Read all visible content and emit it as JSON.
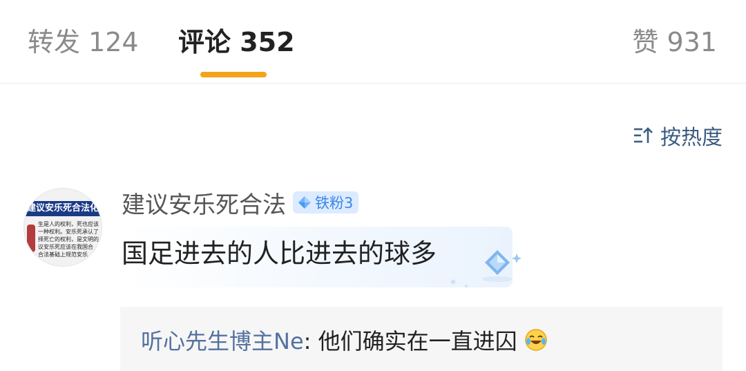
{
  "tabs": {
    "repost_label": "转发 124",
    "comments_label": "评论 352",
    "likes_label": "赞 931",
    "active_color": "#f5a31a"
  },
  "sort": {
    "label": "按热度",
    "icon": "sort-icon"
  },
  "comment": {
    "username": "建议安乐死合法",
    "badge": {
      "label": "铁粉3",
      "icon": "diamond-icon"
    },
    "text": "国足进去的人比进去的球多",
    "avatar": {
      "banner_text": "建议安乐死合法化",
      "body_text": "生是人的权利，死也应该\n一种权利。安乐死承认了\n择死亡的权利，是文明的\n议安乐死应该在我国合\n合法基础上规范安乐"
    },
    "reply": {
      "author": "听心先生博主Ne",
      "separator": ":",
      "text": " 他们确实在一直进囚",
      "emoji": "laughing-crying-emoji"
    }
  },
  "colors": {
    "link_blue": "#5471a0",
    "badge_blue": "#3a86e6",
    "badge_bg": "#dcebff"
  }
}
